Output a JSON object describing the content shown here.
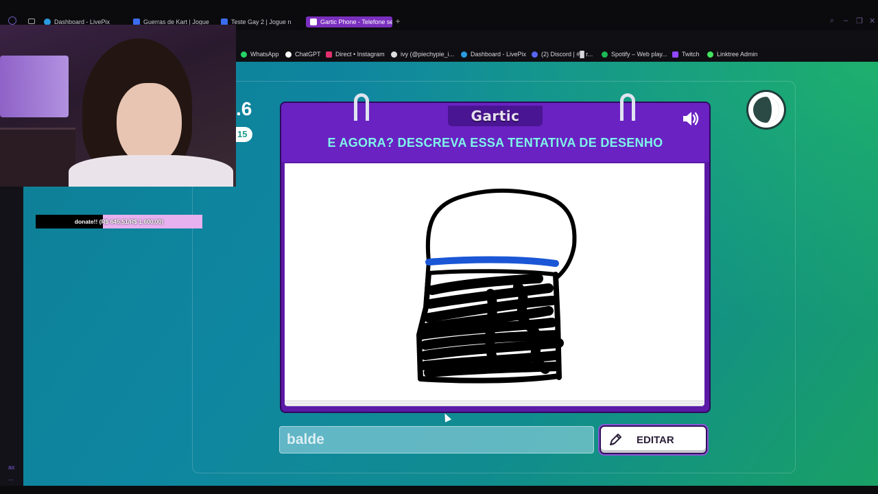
{
  "browser": {
    "tabs": [
      {
        "label": "Dashboard - LivePix",
        "color": "#2a9be0"
      },
      {
        "label": "Guerras de Kart | Jogue n",
        "color": "#3b6cf2"
      },
      {
        "label": "Teste Gay 2 | Jogue n",
        "color": "#3b6cf2"
      },
      {
        "label": "Gartic Phone - Telefone se",
        "color": "#ffffff",
        "active": true
      }
    ],
    "bookmarks": [
      {
        "label": "WhatsApp",
        "color": "#25d366"
      },
      {
        "label": "ChatGPT",
        "color": "#ffffff"
      },
      {
        "label": "Direct • Instagram",
        "color": "#e1306c"
      },
      {
        "label": "ivy (@piechypie_i...",
        "color": "#ffffff"
      },
      {
        "label": "Dashboard - LivePix",
        "color": "#2a9be0"
      },
      {
        "label": "(2) Discord | #█ r...",
        "color": "#5865f2"
      },
      {
        "label": "Spotify – Web play...",
        "color": "#1db954"
      },
      {
        "label": "Twitch",
        "color": "#9146ff"
      },
      {
        "label": "Linktree Admin",
        "color": "#43e55e"
      }
    ]
  },
  "overlay": {
    "donate_text": "donate!! (R$ 645,51/R$ 1.600,00)",
    "donate_progress": 0.4034
  },
  "sidebar": {
    "label_ax": "ax",
    "label_dots": "..."
  },
  "game": {
    "round_number": ".6",
    "round_badge": "15",
    "logo": "Gartic",
    "headline": "E AGORA? DESCREVA ESSA TENTATIVA DE DESENHO",
    "answer_value": "balde",
    "edit_label": "EDITAR",
    "icons": {
      "sound": "speaker-icon",
      "timer": "timer-icon",
      "edit": "pencil-icon"
    },
    "colors": {
      "card": "#6a22c2",
      "headline": "#7ff3ea",
      "stroke_blue": "#1a56d6"
    }
  }
}
